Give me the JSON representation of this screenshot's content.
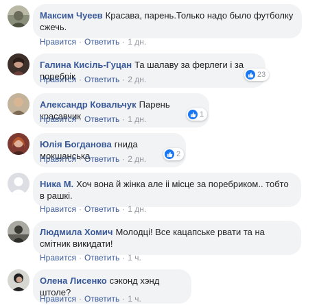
{
  "colors": {
    "author_link": "#385898",
    "bubble_bg": "#f2f3f5",
    "meta_gray": "#90949c",
    "like_blue": "#1877f2"
  },
  "action_labels": {
    "like": "Нравится",
    "reply": "Ответить",
    "separator": "·"
  },
  "comments": [
    {
      "author": "Максим Чуеев",
      "text": "Красава, парень.Только надо было футболку сжечь.",
      "time": "1 дн.",
      "avatar_icon": "user-avatar-icon"
    },
    {
      "author": "Галина Кисіль-Гуцан",
      "text": "Та шалаву за ферлеги і за поребрік",
      "time": "2 дн.",
      "reaction_count": "23",
      "reaction_icon": "like-icon",
      "avatar_icon": "user-avatar-icon"
    },
    {
      "author": "Александр Ковальчук",
      "text": "Парень красавчик",
      "time": "1 дн.",
      "reaction_count": "1",
      "reaction_icon": "like-icon",
      "avatar_icon": "user-avatar-icon"
    },
    {
      "author": "Юлія Богданова",
      "text": "гнида мокшанська",
      "time": "2 дн.",
      "reaction_count": "2",
      "reaction_icon": "like-icon",
      "avatar_icon": "user-avatar-icon"
    },
    {
      "author": "Ника М.",
      "text": "Хоч вона й жінка але іі місце за поребриком.. тобто в рашкі.",
      "time": "1 дн.",
      "avatar_icon": "default-user-silhouette-icon"
    },
    {
      "author": "Людмила Хомич",
      "text": "Молодці! Все кацапське рвати та на смітник викидати!",
      "time": "1 ч.",
      "avatar_icon": "user-avatar-icon"
    },
    {
      "author": "Олена Лисенко",
      "text": "сэконд хэнд штоле?",
      "time": "1 ч.",
      "avatar_icon": "user-avatar-icon"
    }
  ]
}
